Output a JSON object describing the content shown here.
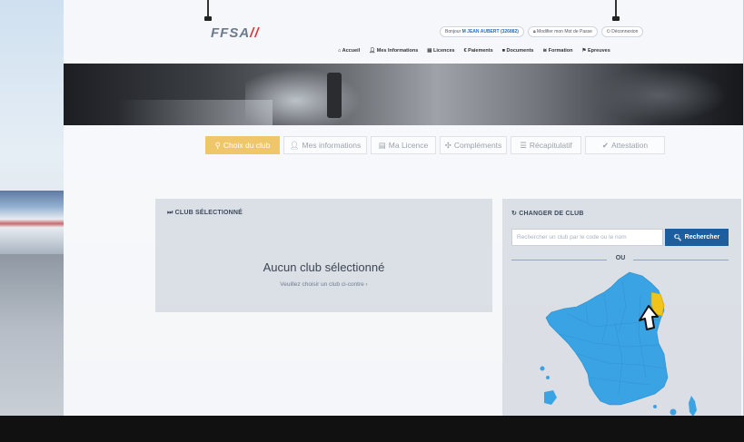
{
  "brand": {
    "logo_text": "FFSA",
    "logo_suffix": "//"
  },
  "topbar": {
    "greeting_prefix": "Bonjour",
    "user": "M JEAN AUBERT (326882)",
    "change_password": "Modifier mon Mot de Passe",
    "logout": "Déconnexion"
  },
  "nav": {
    "items": [
      {
        "icon": "home-icon",
        "label": "Accueil"
      },
      {
        "icon": "user-icon",
        "label": "Mes Informations"
      },
      {
        "icon": "card-icon",
        "label": "Licences"
      },
      {
        "icon": "euro-icon",
        "label": "Paiements"
      },
      {
        "icon": "folder-icon",
        "label": "Documents"
      },
      {
        "icon": "graduation-icon",
        "label": "Formation"
      },
      {
        "icon": "flag-icon",
        "label": "Epreuves"
      }
    ]
  },
  "steps": [
    {
      "icon": "marker-icon",
      "label": "Choix du club",
      "active": true
    },
    {
      "icon": "user-icon",
      "label": "Mes informations",
      "active": false
    },
    {
      "icon": "card-icon",
      "label": "Ma Licence",
      "active": false
    },
    {
      "icon": "puzzle-icon",
      "label": "Compléments",
      "active": false
    },
    {
      "icon": "list-icon",
      "label": "Récapitulatif",
      "active": false
    },
    {
      "icon": "check-circle-icon",
      "label": "Attestation",
      "active": false
    }
  ],
  "selected_club": {
    "title": "CLUB SÉLECTIONNÉ",
    "empty_message": "Aucun club sélectionné",
    "hint": "Veuillez choisir un club ci-contre ›"
  },
  "change_club": {
    "title": "CHANGER DE CLUB",
    "search_placeholder": "Rechercher un club par le code ou le nom",
    "search_button": "Rechercher",
    "separator": "OU"
  },
  "colors": {
    "accent_active_step": "#f0c66a",
    "primary_button": "#1d5f9e",
    "map_fill": "#3aa3e3",
    "map_highlight": "#f2c318"
  }
}
